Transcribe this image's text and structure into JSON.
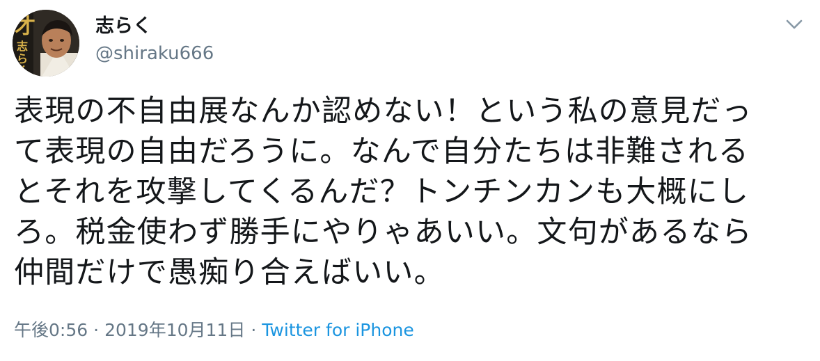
{
  "author": {
    "name": "志らく",
    "handle": "@shiraku666",
    "avatar_text": "才 志らく"
  },
  "tweet": {
    "lines": [
      "表現の不自由展なんか認めない！という私の意見だっ",
      "て表現の自由だろうに。なんで自分たちは非難される",
      "とそれを攻撃してくるんだ？トンチンカンも大概にし",
      "ろ。税金使わず勝手にやりゃあいい。文句があるなら",
      "仲間だけで愚痴り合えばいい。"
    ]
  },
  "meta": {
    "time": "午後0:56",
    "date": "2019年10月11日",
    "separator": "·",
    "source": "Twitter for iPhone"
  },
  "icons": {
    "menu": "chevron-down-icon"
  },
  "colors": {
    "text": "#14171a",
    "secondary": "#657786",
    "link": "#1b95e0"
  }
}
